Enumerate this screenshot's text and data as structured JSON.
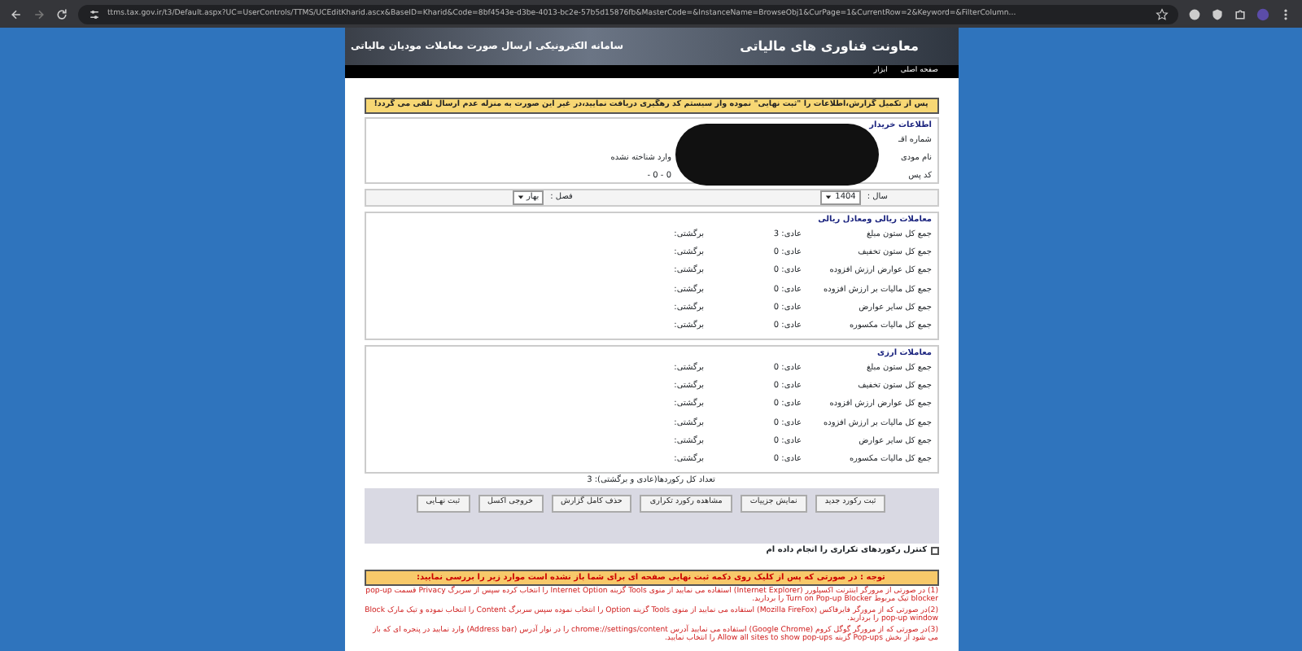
{
  "browser": {
    "url": "ttms.tax.gov.ir/t3/Default.aspx?UC=UserControls/TTMS/UCEditKharid.ascx&BaseID=Kharid&Code=8bf4543e-d3be-4013-bc2e-57b5d15876fb&MasterCode=&InstanceName=BrowseObj1&CurPage=1&CurrentRow=2&Keyword=&FilterColumn..."
  },
  "header": {
    "agency": "معاونت فناوری های مالیاتی",
    "system_title": "سامانه الکترونیکی ارسال صورت معاملات مودیان مالیاتی"
  },
  "nav": [
    "صفحه اصلی",
    "ابزار"
  ],
  "notice": "پس از تکمیل گزارش،اطلاعات را \"ثبت نهایی\" نموده واز سیستم کد رهگیری دریافت نمایید،در غیر این صورت به منزله عدم ارسال تلقی می گردد!",
  "buyer": {
    "title": "اطلاعات خریدار",
    "fields": [
      {
        "label": "شماره اقـ"
      },
      {
        "label": "نام مودی",
        "value": "وارد شناخته نشده"
      },
      {
        "label": "کد پس",
        "value": "0 - 0 -"
      }
    ]
  },
  "period": {
    "year_label": "سال :",
    "year": "1404",
    "season_label": "فصل :",
    "season": "بهار"
  },
  "sections": [
    {
      "title": "معاملات ریالی ومعادل ریالی",
      "rows": [
        {
          "label": "جمع کل ستون مبلغ",
          "normal": "عادی: 3",
          "returned": "برگشتی:"
        },
        {
          "label": "جمع کل ستون تخفیف",
          "normal": "عادی: 0",
          "returned": "برگشتی:"
        },
        {
          "label": "جمع کل عوارض ارزش افزوده",
          "normal": "عادی: 0",
          "returned": "برگشتی:"
        },
        {
          "label": "جمع کل مالیات بر ارزش افزوده",
          "normal": "عادی: 0",
          "returned": "برگشتی:"
        },
        {
          "label": "جمع کل سایر عوارض",
          "normal": "عادی: 0",
          "returned": "برگشتی:"
        },
        {
          "label": "جمع کل مالیات مکسوره",
          "normal": "عادی: 0",
          "returned": "برگشتی:"
        }
      ]
    },
    {
      "title": "معاملات ارزی",
      "rows": [
        {
          "label": "جمع کل ستون مبلغ",
          "normal": "عادی: 0",
          "returned": "برگشتی:"
        },
        {
          "label": "جمع کل ستون تخفیف",
          "normal": "عادی: 0",
          "returned": "برگشتی:"
        },
        {
          "label": "جمع کل عوارض ارزش افزوده",
          "normal": "عادی: 0",
          "returned": "برگشتی:"
        },
        {
          "label": "جمع کل مالیات بر ارزش افزوده",
          "normal": "عادی: 0",
          "returned": "برگشتی:"
        },
        {
          "label": "جمع کل سایر عوارض",
          "normal": "عادی: 0",
          "returned": "برگشتی:"
        },
        {
          "label": "جمع کل مالیات مکسوره",
          "normal": "عادی: 0",
          "returned": "برگشتی:"
        }
      ]
    }
  ],
  "record_count": "تعداد کل رکوردها(عادی و برگشتی): 3",
  "buttons": [
    "ثبت رکورد جدید",
    "نمایش جزییات",
    "مشاهده رکورد تکراری",
    "حذف کامل گزارش",
    "خروجی اکسل",
    "ثبت نهـایی"
  ],
  "duplicate_check": {
    "label": "کنترل رکوردهای تکراری را انجام داده ام",
    "checked": false
  },
  "attention": "توجه : در صورتی که پس از کلیک روی دکمه ثبت نهایی صفحه ای برای شما باز نشده است موارد زیر را بررسی نمایید:",
  "instructions": [
    "(1) در صورتی از مرورگر اینترنت اکسپلورر (Internet Explorer) استفاده می نمایید از منوی Tools گزینه Internet Option را انتخاب کرده سپس از سربرگ Privacy قسمت pop-up blocker تیک مربوط Turn on Pop-up Blocker را بردارید.",
    "(2)در صورتی که از مرورگر فایرفاکس (Mozilla FireFox) استفاده می نمایید از منوی Tools گزینه Option را انتخاب نموده سپس سربرگ Content را انتخاب نموده و تیک مارک Block pop-up window را بردارید.",
    "(3)در صورتی که از مرورگر گوگل کروم (Google Chrome) استفاده می نمایید آدرس chrome://settings/content را در نوار آدرس (Address bar) وارد نمایید در پنجره ای که باز می شود از بخش Pop-ups گزینه Allow all sites to show pop-ups را انتخاب نمایید."
  ]
}
